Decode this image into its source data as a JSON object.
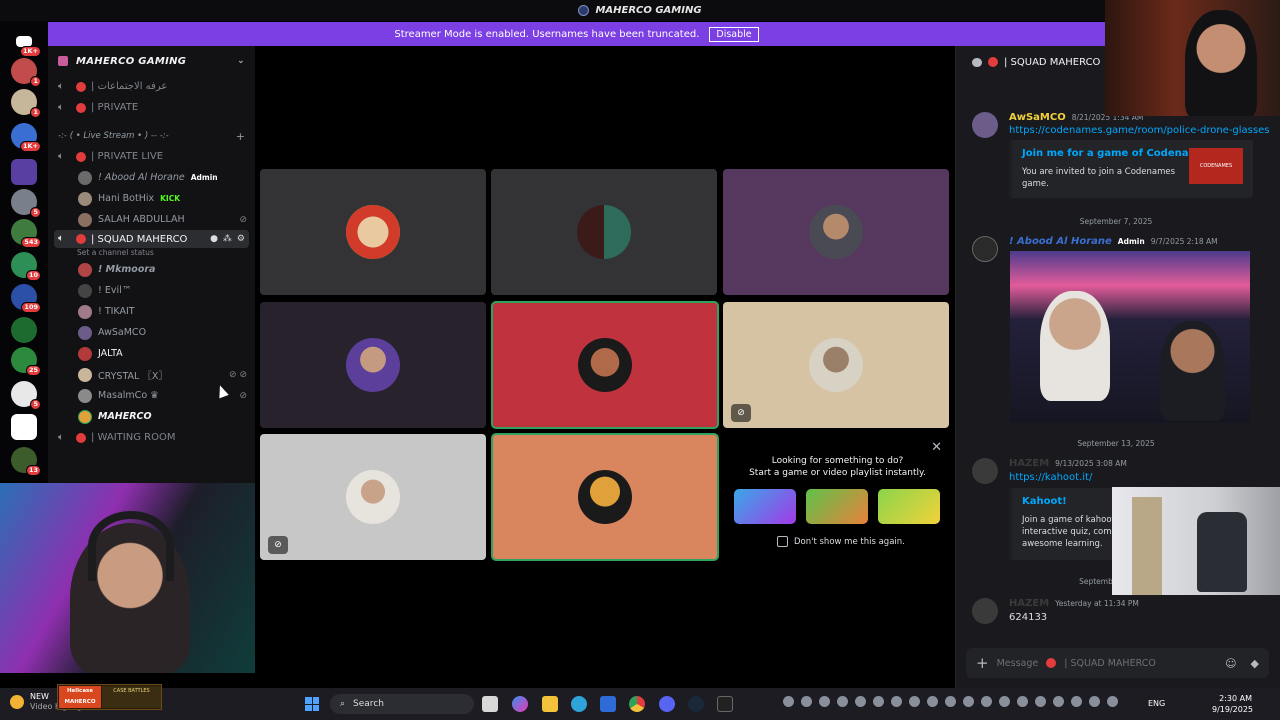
{
  "window": {
    "title": "MAHERCO GAMING"
  },
  "banner": {
    "text": "Streamer Mode is enabled. Usernames have been truncated.",
    "button": "Disable"
  },
  "rail": {
    "badges": [
      "1K+",
      "1",
      "1",
      "1K+",
      "",
      "5",
      "543",
      "10",
      "109",
      "",
      "25",
      "5",
      "",
      "13",
      "8"
    ]
  },
  "sidebar": {
    "server_name": "MAHERCO GAMING",
    "channels_top": [
      {
        "name": "| عرفه الاجتماعات"
      },
      {
        "name": "| PRIVATE"
      }
    ],
    "category": "-:- ( • Live Stream • ) -- -:-",
    "private_live": {
      "name": "| PRIVATE LIVE"
    },
    "private_live_members": [
      {
        "name": "! Abood Al Horane",
        "tag": "Admin",
        "style": "italic"
      },
      {
        "name": "Hani BotHix",
        "tag": "KICK",
        "style": ""
      },
      {
        "name": "SALAH ABDULLAH",
        "tag": "",
        "style": ""
      }
    ],
    "squad": {
      "name": "| SQUAD MAHERCO",
      "status_hint": "Set a channel status"
    },
    "squad_members": [
      {
        "name": "! Mkmoora"
      },
      {
        "name": "! Evil™"
      },
      {
        "name": "! TIKAIT"
      },
      {
        "name": "AwSaMCO"
      },
      {
        "name": "JALTA"
      },
      {
        "name": "CRYSTAL 〖X〗"
      },
      {
        "name": "MasalmCo ♛"
      },
      {
        "name": "MAHERCO"
      }
    ],
    "waiting": {
      "name": "| WAITING ROOM"
    }
  },
  "stage": {
    "activity": {
      "line1": "Looking for something to do?",
      "line2": "Start a game or video playlist instantly.",
      "checkbox": "Don't show me this again."
    }
  },
  "chat": {
    "channel": "| SQUAD MAHERCO",
    "dividers": {
      "d0": "Augu",
      "d1": "September 7, 2025",
      "d2": "September 13, 2025",
      "d3": "Septemb"
    },
    "messages": [
      {
        "author": "AwSaMCO",
        "time": "8/21/2025 1:34 AM",
        "link": "https://codenames.game/room/police-drone-glasses",
        "embed_title": "Join me for a game of Codenames",
        "embed_desc_1": "You are invited to join a Codenames",
        "embed_desc_2": "game.",
        "embed_thumb": "CODENAMES"
      },
      {
        "author": "! Abood Al Horane",
        "tag": "Admin",
        "time": "9/7/2025 2:18 AM"
      },
      {
        "author": "HAZEM",
        "time": "9/13/2025 3:08 AM",
        "link": "https://kahoot.it/",
        "embed_title": "Kahoot!",
        "embed_desc_1": "Join a game of kahoot -",
        "embed_desc_2": "interactive quiz, compe",
        "embed_desc_3": "awesome learning."
      },
      {
        "author": "HAZEM",
        "time": "Yesterday at 11:34 PM",
        "text": "624133"
      }
    ],
    "composer_placeholder": "Message",
    "composer_channel": "| SQUAD MAHERCO"
  },
  "taskbar": {
    "weather_title": "NEW",
    "weather_sub": "Video highlight",
    "promo_a": "Hellcase MAHERCO",
    "promo_b": "CASE BATTLES",
    "search": "Search",
    "lang": "ENG",
    "time": "2:30 AM",
    "date": "9/19/2025"
  },
  "colors": {
    "accent": "#7b3fe4",
    "speaking": "#2fa25c",
    "live": "#e23c3c",
    "link": "#00a8fc"
  }
}
